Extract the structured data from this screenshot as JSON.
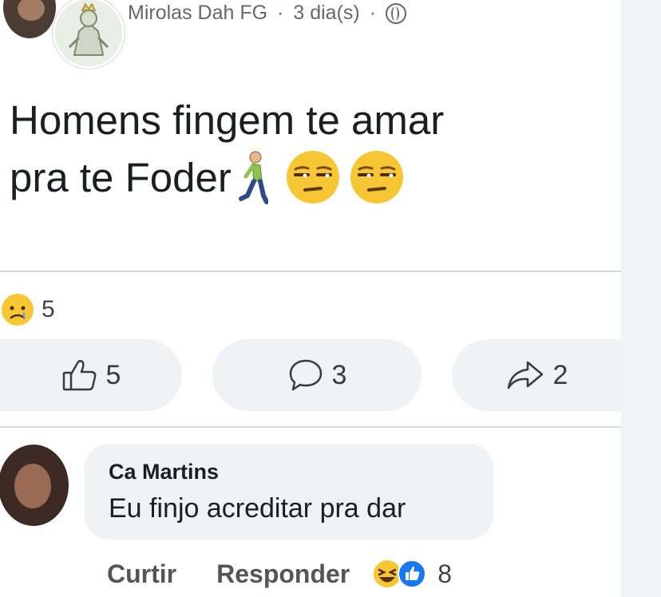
{
  "post": {
    "author": "Mirolas Dah FG",
    "separator": "·",
    "time": "3 dia(s)",
    "audience_icon": "globe-icon",
    "text_line1": "Homens fingem te amar",
    "text_line2": "pra te Foder",
    "emojis": [
      "person-walking-icon",
      "unamused-face-icon",
      "unamused-face-icon"
    ]
  },
  "reactions": {
    "icon": "sad-face-icon",
    "count": "5"
  },
  "actions": {
    "like_count": "5",
    "comment_count": "3",
    "share_count": "2"
  },
  "comment": {
    "author": "Ca Martins",
    "text": "Eu finjo acreditar pra dar",
    "like_label": "Curtir",
    "reply_label": "Responder",
    "reaction_icons": [
      "laughing-face-icon",
      "like-icon"
    ],
    "reaction_count": "8"
  },
  "colors": {
    "secondary_text": "#65676b",
    "pill_background": "#f0f2f5",
    "emoji_yellow": "#f7c634"
  }
}
